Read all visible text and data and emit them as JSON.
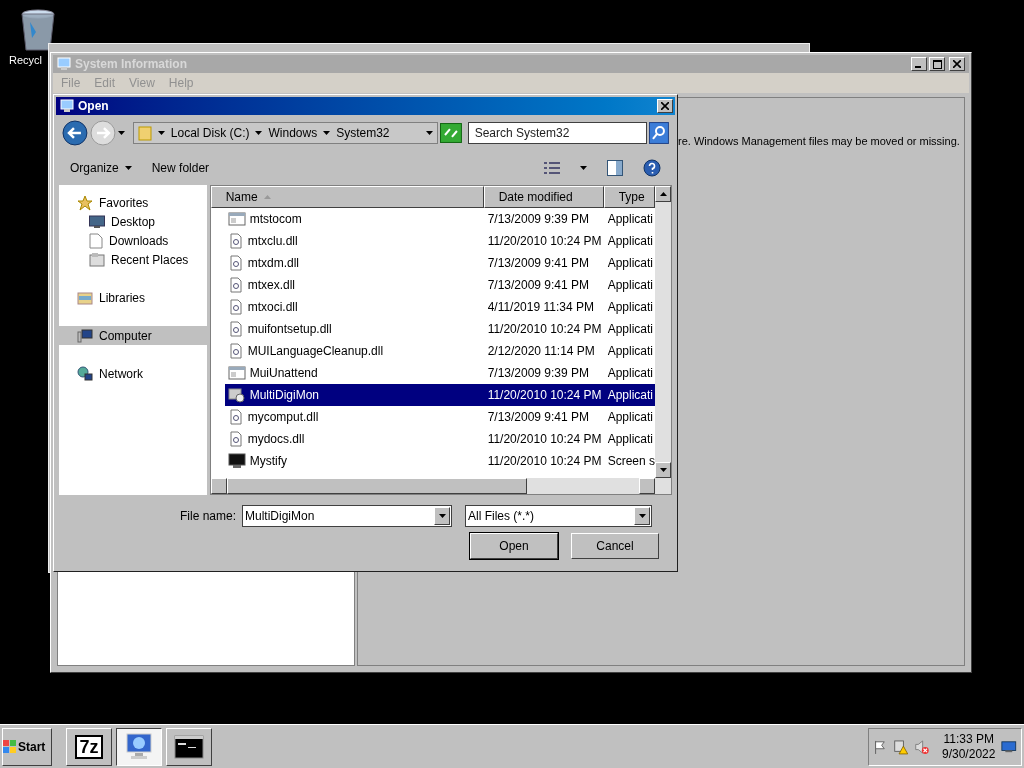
{
  "desktop": {
    "icons": [
      {
        "label": "Recycl"
      }
    ]
  },
  "sysinfo": {
    "title": "System Information",
    "menu": [
      "File",
      "Edit",
      "View",
      "Help"
    ],
    "message": "re. Windows Management files may be moved or missing."
  },
  "dialog": {
    "title": "Open",
    "breadcrumbs": [
      "Local Disk (C:)",
      "Windows",
      "System32"
    ],
    "search": {
      "placeholder": "Search System32"
    },
    "toolbar": [
      "Organize",
      "New folder"
    ],
    "nav": [
      {
        "label": "Favorites",
        "kind": "favorites",
        "selected": false,
        "children": [
          {
            "label": "Desktop",
            "kind": "desktop",
            "selected": false
          },
          {
            "label": "Downloads",
            "kind": "downloads",
            "selected": false
          },
          {
            "label": "Recent Places",
            "kind": "recent",
            "selected": false
          }
        ]
      },
      {
        "label": "Libraries",
        "kind": "libraries",
        "selected": false
      },
      {
        "label": "Computer",
        "kind": "computer",
        "selected": true
      },
      {
        "label": "Network",
        "kind": "network",
        "selected": false
      }
    ],
    "columns": [
      "Name",
      "Date modified",
      "Type"
    ],
    "rows": [
      {
        "name": "mtstocom",
        "date": "7/13/2009 9:39 PM",
        "type": "Applicati",
        "kind": "app",
        "selected": false
      },
      {
        "name": "mtxclu.dll",
        "date": "11/20/2010 10:24 PM",
        "type": "Applicati",
        "kind": "dll",
        "selected": false
      },
      {
        "name": "mtxdm.dll",
        "date": "7/13/2009 9:41 PM",
        "type": "Applicati",
        "kind": "dll",
        "selected": false
      },
      {
        "name": "mtxex.dll",
        "date": "7/13/2009 9:41 PM",
        "type": "Applicati",
        "kind": "dll",
        "selected": false
      },
      {
        "name": "mtxoci.dll",
        "date": "4/11/2019 11:34 PM",
        "type": "Applicati",
        "kind": "dll",
        "selected": false
      },
      {
        "name": "muifontsetup.dll",
        "date": "11/20/2010 10:24 PM",
        "type": "Applicati",
        "kind": "dll",
        "selected": false
      },
      {
        "name": "MUILanguageCleanup.dll",
        "date": "2/12/2020 11:14 PM",
        "type": "Applicati",
        "kind": "dll",
        "selected": false
      },
      {
        "name": "MuiUnattend",
        "date": "7/13/2009 9:39 PM",
        "type": "Applicati",
        "kind": "app",
        "selected": false
      },
      {
        "name": "MultiDigiMon",
        "date": "11/20/2010 10:24 PM",
        "type": "Applicati",
        "kind": "tool",
        "selected": true
      },
      {
        "name": "mycomput.dll",
        "date": "7/13/2009 9:41 PM",
        "type": "Applicati",
        "kind": "dll",
        "selected": false
      },
      {
        "name": "mydocs.dll",
        "date": "11/20/2010 10:24 PM",
        "type": "Applicati",
        "kind": "dll",
        "selected": false
      },
      {
        "name": "Mystify",
        "date": "11/20/2010 10:24 PM",
        "type": "Screen s",
        "kind": "screensaver",
        "selected": false
      }
    ],
    "file_name": {
      "label": "File name:",
      "value": "MultiDigiMon"
    },
    "filter": "All Files (*.*)",
    "buttons": [
      "Open",
      "Cancel"
    ]
  },
  "taskbar": {
    "start": "Start",
    "buttons": [
      {
        "kind": "sevenzip",
        "label": "7z",
        "selected": false
      },
      {
        "kind": "sysinfo",
        "selected": true
      },
      {
        "kind": "console",
        "selected": false
      }
    ],
    "clock": {
      "time": "11:33 PM",
      "date": "9/30/2022"
    }
  }
}
